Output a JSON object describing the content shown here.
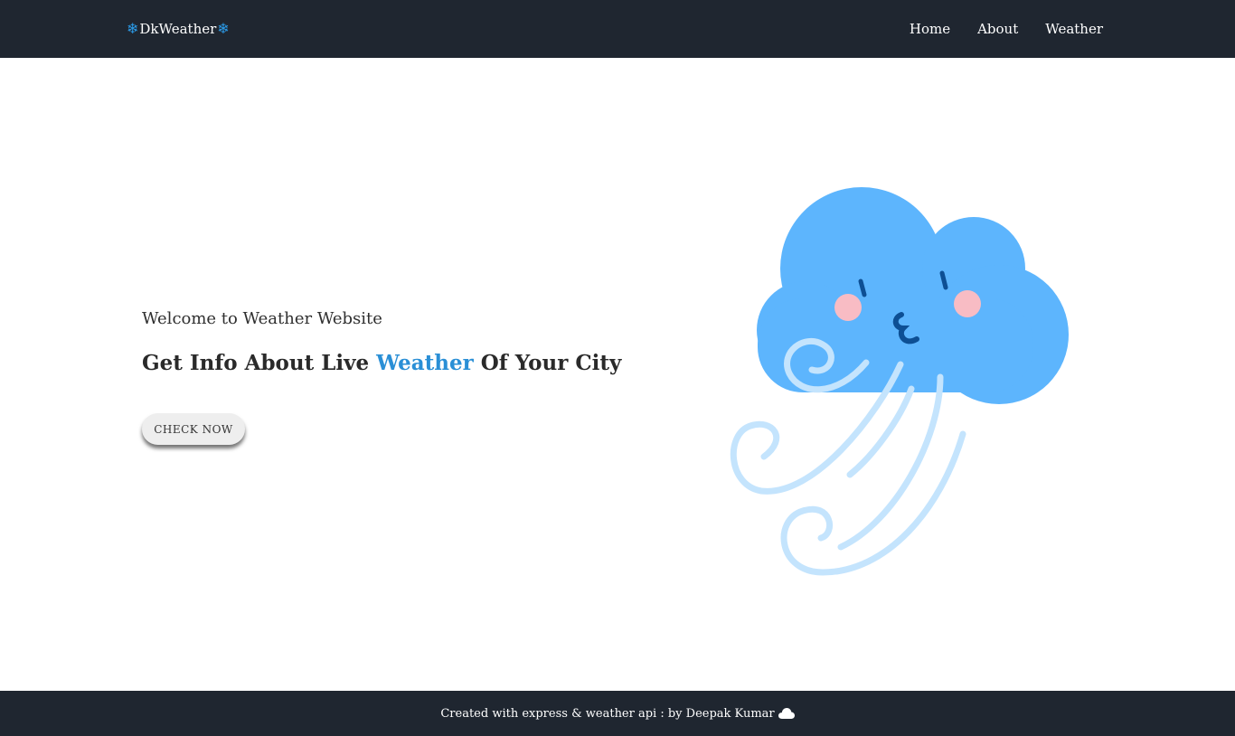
{
  "navbar": {
    "brand": {
      "text": "DkWeather",
      "left_icon": "snowflake-icon",
      "right_icon": "snowflake-icon",
      "icon_glyph": "❄",
      "icon_color": "#2b9be8"
    },
    "links": [
      {
        "label": "Home"
      },
      {
        "label": "About"
      },
      {
        "label": "Weather"
      }
    ],
    "background": "#1f2630"
  },
  "hero": {
    "subtitle": "Welcome to Weather Website",
    "headline_before": "Get Info About Live ",
    "headline_accent": "Weather",
    "headline_after": " Of Your City",
    "accent_color": "#2a8fd6",
    "button_label": "CHECK NOW",
    "illustration": "windy-cloud-illustration"
  },
  "footer": {
    "text": "Created with express & weather api : by Deepak Kumar",
    "icon": "cloud-icon"
  },
  "colors": {
    "cloud": "#5db5fd",
    "wind": "#c4e4fd",
    "cheek": "#f8bcc4",
    "face": "#0d4f94"
  }
}
